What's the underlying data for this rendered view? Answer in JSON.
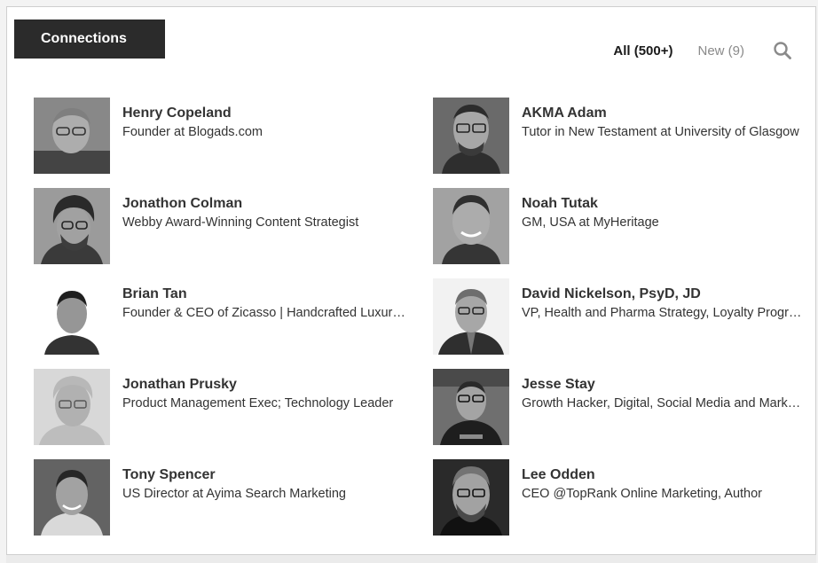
{
  "header": {
    "title": "Connections",
    "filters": {
      "all_label": "All (500+)",
      "new_label": "New (9)"
    },
    "search_icon": "search-icon"
  },
  "colors": {
    "tab_bg": "#2b2b2b",
    "tab_text": "#ffffff",
    "active_filter": "#1a1a1a",
    "inactive_filter": "#8a8a8a"
  },
  "connections": [
    {
      "name": "Henry Copeland",
      "headline": "Founder at Blogads.com"
    },
    {
      "name": "AKMA Adam",
      "headline": "Tutor in New Testament at University of Glasgow"
    },
    {
      "name": "Jonathon Colman",
      "headline": "Webby Award-Winning Content Strategist"
    },
    {
      "name": "Noah Tutak",
      "headline": "GM, USA at MyHeritage"
    },
    {
      "name": "Brian Tan",
      "headline": "Founder & CEO of Zicasso | Handcrafted Luxury Travel"
    },
    {
      "name": "David Nickelson, PsyD, JD",
      "headline": "VP, Health and Pharma Strategy, Loyalty Programs"
    },
    {
      "name": "Jonathan Prusky",
      "headline": "Product Management Exec; Technology Leader"
    },
    {
      "name": "Jesse Stay",
      "headline": "Growth Hacker, Digital, Social Media and Marketing"
    },
    {
      "name": "Tony Spencer",
      "headline": "US Director at Ayima Search Marketing"
    },
    {
      "name": "Lee Odden",
      "headline": "CEO @TopRank Online Marketing, Author"
    }
  ]
}
